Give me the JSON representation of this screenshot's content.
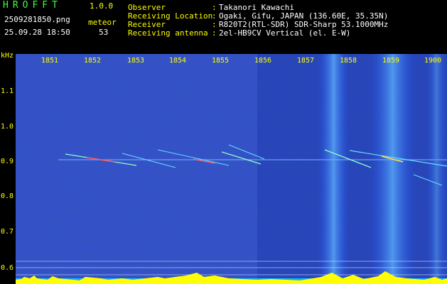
{
  "app": {
    "title": "HROFFT",
    "version": "1.0.0"
  },
  "file": {
    "name": "2509281850.png",
    "timestamp": "25.09.28 18:50"
  },
  "meteor": {
    "label": "meteor",
    "count": "53"
  },
  "info": {
    "rows": [
      {
        "label": "Observer",
        "sep": ":",
        "value": "Takanori Kawachi"
      },
      {
        "label": "Receiving Location",
        "sep": ":",
        "value": "Ogaki, Gifu, JAPAN (136.60E, 35.35N)"
      },
      {
        "label": "Receiver",
        "sep": ":",
        "value": "R820T2(RTL-SDR) SDR-Sharp 53.1000MHz"
      },
      {
        "label": "Receiving antenna",
        "sep": ":",
        "value": "2el-HB9CV Vertical (el. E-W)"
      }
    ]
  },
  "axis": {
    "y_unit": "kHz",
    "y_ticks": [
      "1.1",
      "1.0",
      "0.9",
      "0.8",
      "0.7",
      "0.6"
    ],
    "x_ticks": [
      "1851",
      "1852",
      "1853",
      "1854",
      "1855",
      "1856",
      "1857",
      "1858",
      "1859",
      "1900"
    ]
  },
  "colors": {
    "background": "#000000",
    "spectrum": "#0a1a7a",
    "label": "#ffff00",
    "title": "#3cff3c",
    "info": "#ffffff"
  }
}
